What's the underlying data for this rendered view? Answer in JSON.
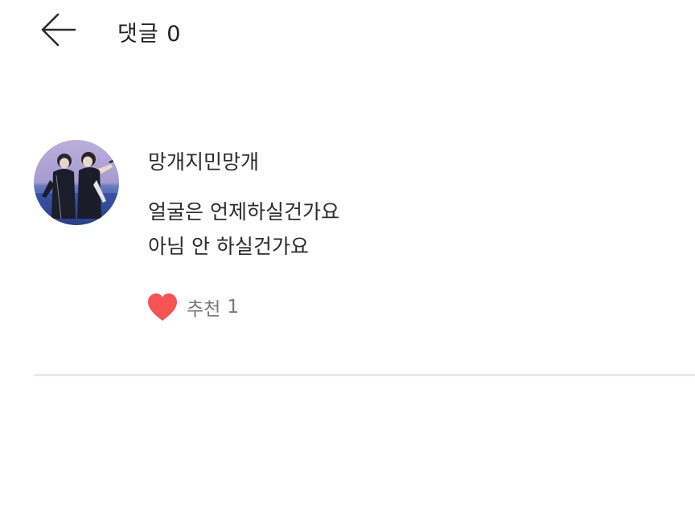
{
  "header": {
    "back_icon": "arrow-left-icon",
    "title": "댓글 0"
  },
  "comment": {
    "avatar_icon": "user-avatar-photo",
    "author": "망개지민망개",
    "lines": [
      "얼굴은 언제하실건가요",
      "아님 안 하실건가요"
    ],
    "like": {
      "icon": "heart-icon",
      "label": "추천",
      "count": "1",
      "color": "#f45454"
    }
  }
}
